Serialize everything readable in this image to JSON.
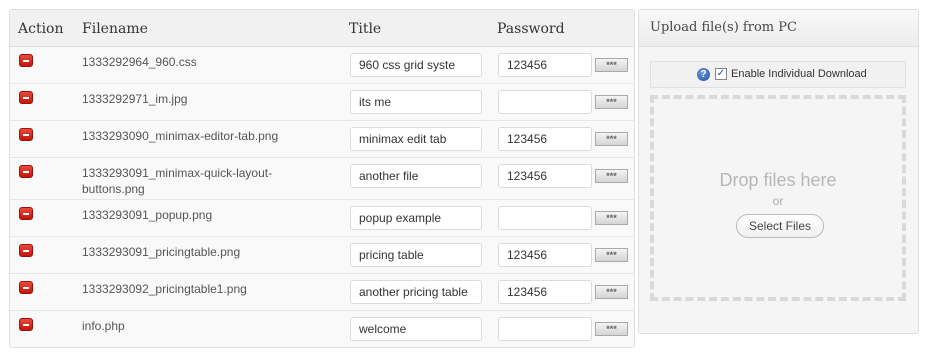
{
  "table": {
    "headers": {
      "action": "Action",
      "filename": "Filename",
      "title": "Title",
      "password": "Password"
    },
    "password_button": "***",
    "rows": [
      {
        "filename": "1333292964_960.css",
        "title": "960 css grid syste",
        "password": "123456"
      },
      {
        "filename": "1333292971_im.jpg",
        "title": "its me",
        "password": ""
      },
      {
        "filename": "1333293090_minimax-editor-tab.png",
        "title": "minimax edit tab",
        "password": "123456"
      },
      {
        "filename": "1333293091_minimax-quick-layout-buttons.png",
        "filename_line1": "1333293091_minimax-quick-layout-",
        "filename_line2": "buttons.png",
        "title": "another file",
        "password": "123456"
      },
      {
        "filename": "1333293091_popup.png",
        "title": "popup example",
        "password": ""
      },
      {
        "filename": "1333293091_pricingtable.png",
        "title": "pricing table",
        "password": "123456"
      },
      {
        "filename": "1333293092_pricingtable1.png",
        "title": "another pricing table",
        "password": "123456"
      },
      {
        "filename": "info.php",
        "title": "welcome",
        "password": ""
      }
    ]
  },
  "upload": {
    "title": "Upload file(s) from PC",
    "help_icon": "?",
    "enable_individual_download": {
      "label": "Enable Individual Download",
      "checked": true
    },
    "drop_text": "Drop files here",
    "or_text": "or",
    "select_button": "Select Files"
  }
}
